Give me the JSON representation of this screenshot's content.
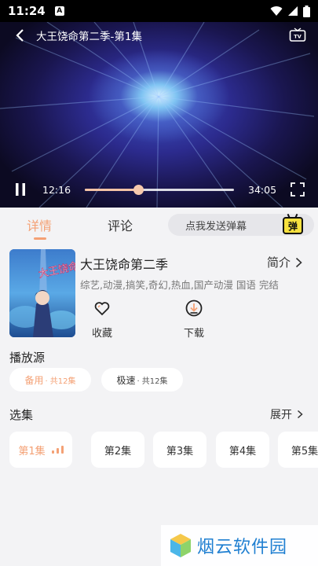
{
  "status_bar": {
    "time": "11:24",
    "app_badge": "A"
  },
  "player": {
    "title": "大王饶命第二季-第1集",
    "current_time": "12:16",
    "total_time": "34:05",
    "progress_fraction": 0.36,
    "accent_color": "#f4c3a6"
  },
  "tabs": [
    {
      "label": "详情",
      "active": true
    },
    {
      "label": "评论",
      "active": false
    }
  ],
  "danmaku": {
    "placeholder": "点我发送弹幕",
    "button_label": "弹"
  },
  "show": {
    "title": "大王饶命第二季",
    "intro_label": "简介",
    "tags": "综艺,动漫,搞笑,奇幻,热血,国产动漫 国语 完结"
  },
  "actions": {
    "favorite_label": "收藏",
    "download_label": "下载"
  },
  "sources": {
    "title": "播放源",
    "items": [
      {
        "name": "备用",
        "count": " · 共12集",
        "active": true
      },
      {
        "name": "极速",
        "count": " · 共12集",
        "active": false
      }
    ]
  },
  "episodes": {
    "title": "选集",
    "expand_label": "展开",
    "items": [
      "第1集",
      "第2集",
      "第3集",
      "第4集",
      "第5集"
    ],
    "active_index": 0
  },
  "watermark": {
    "text": "烟云软件园"
  },
  "colors": {
    "accent": "#f4a175",
    "panel_bg": "#f3f3f5"
  }
}
